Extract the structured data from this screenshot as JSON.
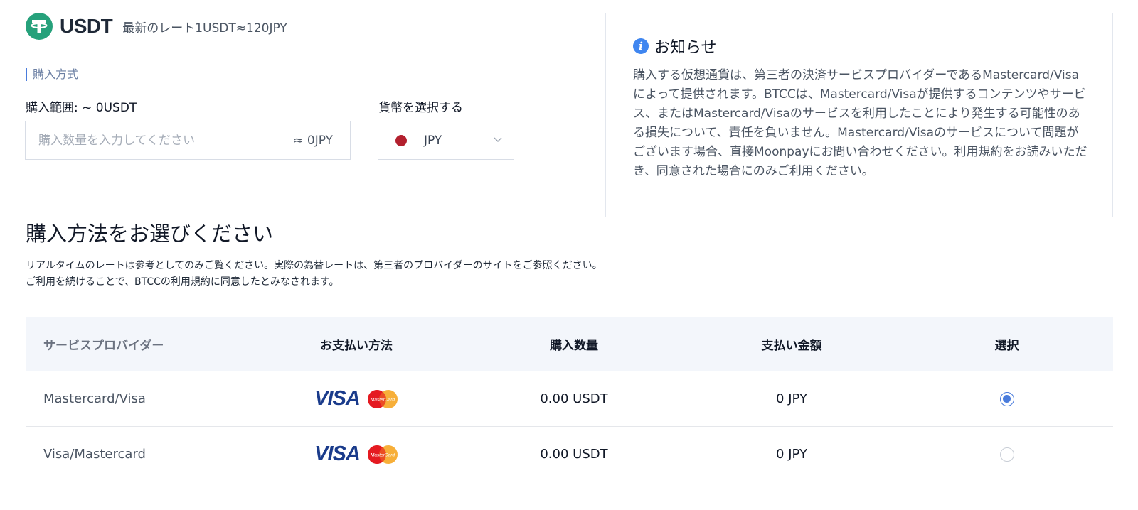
{
  "header": {
    "coin_name": "USDT",
    "rate_text": "最新のレート1USDT≈120JPY",
    "coin_icon": "tether-icon"
  },
  "purchase": {
    "method_label": "購入方式",
    "range_label": "購入範囲: ~ 0USDT",
    "amount_placeholder": "購入数量を入力してください",
    "amount_value": "",
    "approx_value": "≈ 0JPY"
  },
  "currency": {
    "label": "貨幣を選択する",
    "selected": "JPY",
    "flag_color": "#b3202e"
  },
  "notice": {
    "title": "お知らせ",
    "body": "購入する仮想通貨は、第三者の決済サービスプロバイダーであるMastercard/Visaによって提供されます。BTCCは、Mastercard/Visaが提供するコンテンツやサービス、またはMastercard/Visaのサービスを利用したことにより発生する可能性のある損失について、責任を負いません。Mastercard/Visaのサービスについて問題がございます場合、直接Moonpayにお問い合わせください。利用規約をお読みいただき、同意された場合にのみご利用ください。"
  },
  "select_section": {
    "title": "購入方法をお選びください",
    "desc_line1": "リアルタイムのレートは参考としてのみご覧ください。実際の為替レートは、第三者のプロバイダーのサイトをご参照ください。",
    "desc_line2": "ご利用を続けることで、BTCCの利用規約に同意したとみなされます。"
  },
  "table": {
    "headers": [
      "サービスプロバイダー",
      "お支払い方法",
      "購入数量",
      "支払い金額",
      "選択"
    ],
    "rows": [
      {
        "provider": "Mastercard/Visa",
        "payment_logos": [
          "VISA",
          "MasterCard"
        ],
        "quantity": "0.00 USDT",
        "amount": "0 JPY",
        "selected": true
      },
      {
        "provider": "Visa/Mastercard",
        "payment_logos": [
          "VISA",
          "MasterCard"
        ],
        "quantity": "0.00 USDT",
        "amount": "0 JPY",
        "selected": false
      }
    ]
  },
  "colors": {
    "accent": "#4a7cdc",
    "tether_green": "#26a17b",
    "visa_blue": "#1a3b8b",
    "table_header_bg": "#f3f6fb"
  }
}
